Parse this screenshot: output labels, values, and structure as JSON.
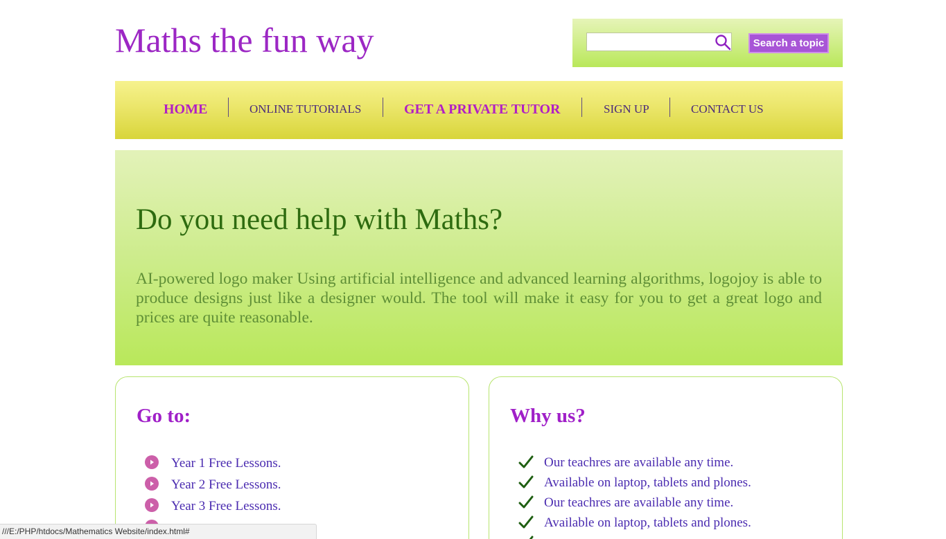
{
  "header": {
    "site_title": "Maths the fun way",
    "search": {
      "value": "",
      "placeholder": "",
      "button_label": "Search a topic",
      "icon": "search-icon"
    }
  },
  "nav": {
    "items": [
      {
        "label": "HOME",
        "emphasis": true
      },
      {
        "label": "ONLINE TUTORIALS",
        "emphasis": false
      },
      {
        "label": "GET A PRIVATE TUTOR",
        "emphasis": true
      },
      {
        "label": "SIGN UP",
        "emphasis": false
      },
      {
        "label": "CONTACT US",
        "emphasis": false
      }
    ]
  },
  "hero": {
    "title": "Do you need help with Maths?",
    "text": "AI-powered logo maker Using artificial intelligence and advanced learning algorithms, logojoy is able to produce designs just like a designer would. The tool will make it easy for you to get a great logo and prices are quite reasonable."
  },
  "goto": {
    "title": "Go to:",
    "icon": "play-circle-icon",
    "items": [
      "Year 1 Free Lessons.",
      "Year 2 Free Lessons.",
      "Year 3 Free Lessons."
    ]
  },
  "why": {
    "title": "Why us?",
    "icon": "checkmark-icon",
    "items": [
      "Our teachres are available any time.",
      "Available on laptop, tablets and plones.",
      "Our teachres are available any time.",
      "Available on laptop, tablets and plones."
    ]
  },
  "status_bar": {
    "url": "///E:/PHP/htdocs/Mathematics Website/index.html#"
  },
  "colors": {
    "title_purple": "#9c27c4",
    "nav_yellow": "#ebe66a",
    "hero_green": "#cdec8c",
    "button_purple": "#a855d6",
    "list_text": "#4a2bb0",
    "check_green": "#1f5f12",
    "bullet_pink": "#cc5fa9"
  }
}
